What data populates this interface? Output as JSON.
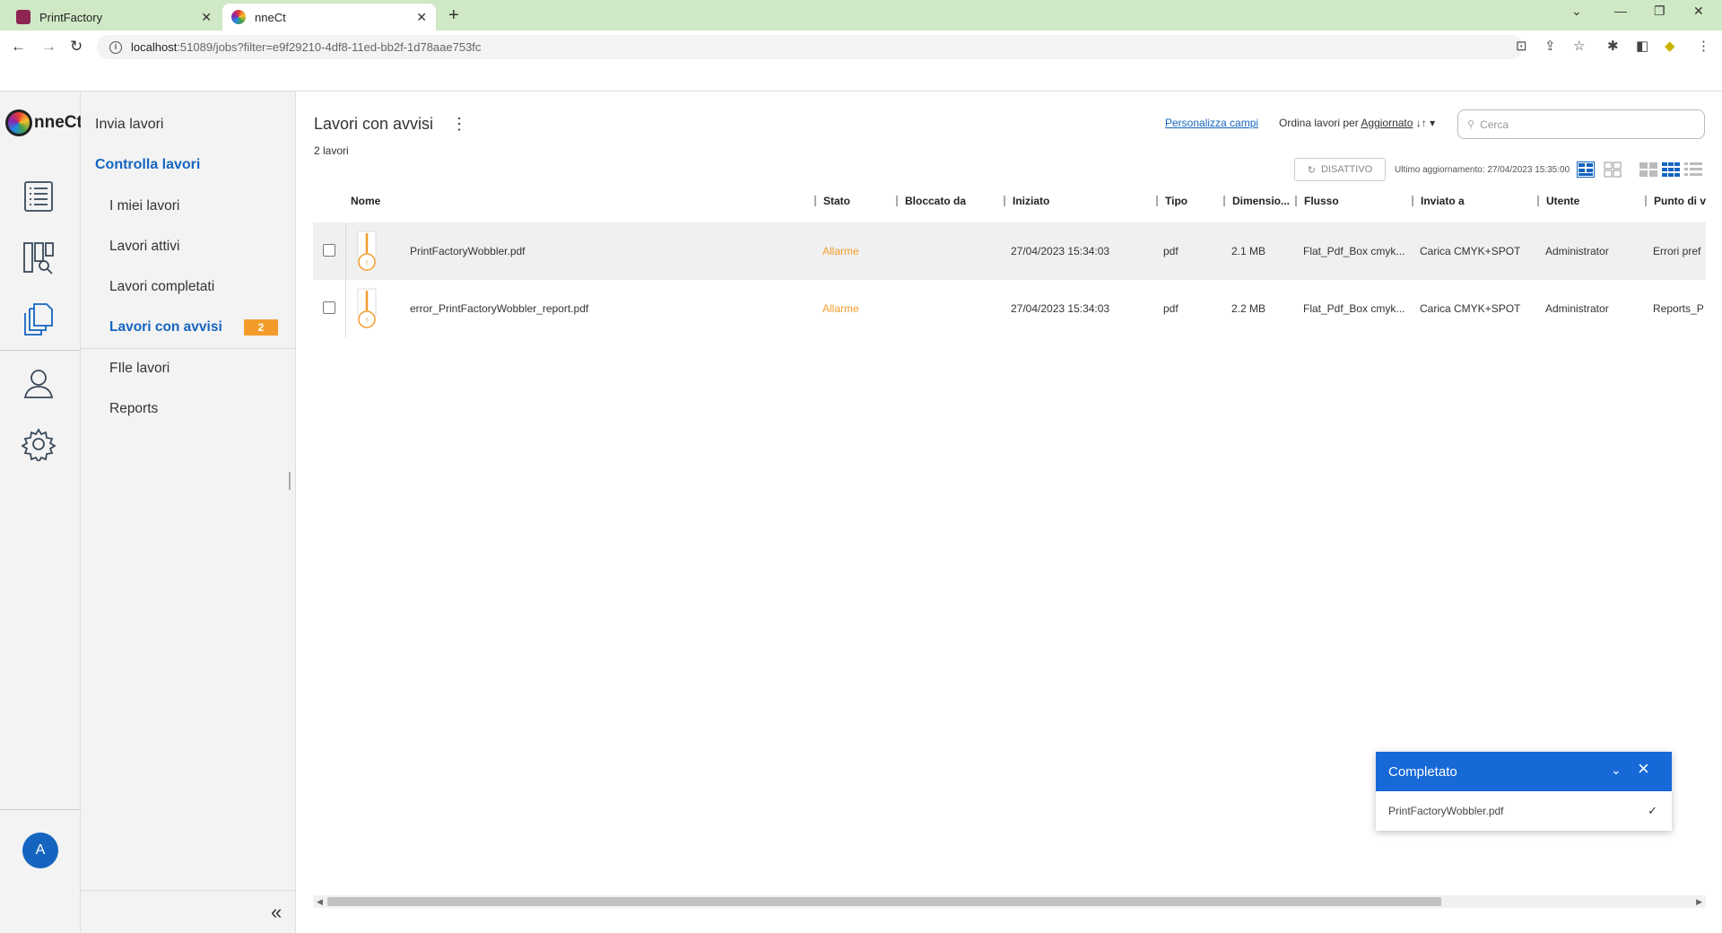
{
  "browser": {
    "tabs": [
      {
        "title": "PrintFactory",
        "active": false
      },
      {
        "title": "nneCt",
        "active": true
      }
    ],
    "url_host": "localhost",
    "url_rest": ":51089/jobs?filter=e9f29210-4df8-11ed-bb2f-1d78aae753fc"
  },
  "app": {
    "logo_text": "nneCt",
    "avatar_initial": "A"
  },
  "sidebar": {
    "items": [
      {
        "label": "Invia lavori"
      },
      {
        "label": "Controlla lavori"
      },
      {
        "label": "I miei lavori"
      },
      {
        "label": "Lavori attivi"
      },
      {
        "label": "Lavori completati"
      },
      {
        "label": "Lavori con avvisi"
      },
      {
        "label": "FIle lavori"
      },
      {
        "label": "Reports"
      }
    ],
    "warnings_badge": "2"
  },
  "main": {
    "title": "Lavori con avvisi",
    "job_count": "2 lavori",
    "customize_link": "Personalizza campi",
    "sort_prefix": "Ordina lavori per",
    "sort_value": "Aggiornato",
    "search_placeholder": "Cerca",
    "refresh_label": "DISATTIVO",
    "last_update": "Ultimo aggiornamento: 27/04/2023 15:35:00"
  },
  "table": {
    "columns": [
      "Nome",
      "Stato",
      "Bloccato da",
      "Iniziato",
      "Tipo",
      "Dimensio...",
      "Flusso",
      "Inviato a",
      "Utente",
      "Punto di v"
    ],
    "rows": [
      {
        "name": "PrintFactoryWobbler.pdf",
        "status": "Allarme",
        "locked_by": "",
        "started": "27/04/2023 15:34:03",
        "type": "pdf",
        "size": "2.1 MB",
        "flow": "Flat_Pdf_Box cmyk...",
        "sent_to": "Carica CMYK+SPOT",
        "user": "Administrator",
        "point": "Errori pref"
      },
      {
        "name": "error_PrintFactoryWobbler_report.pdf",
        "status": "Allarme",
        "locked_by": "",
        "started": "27/04/2023 15:34:03",
        "type": "pdf",
        "size": "2.2 MB",
        "flow": "Flat_Pdf_Box cmyk...",
        "sent_to": "Carica CMYK+SPOT",
        "user": "Administrator",
        "point": "Reports_P"
      }
    ]
  },
  "toast": {
    "title": "Completato",
    "item": "PrintFactoryWobbler.pdf"
  },
  "colors": {
    "accent": "#1565c0",
    "warning": "#f39c2b",
    "toast_header": "#1769d8"
  }
}
